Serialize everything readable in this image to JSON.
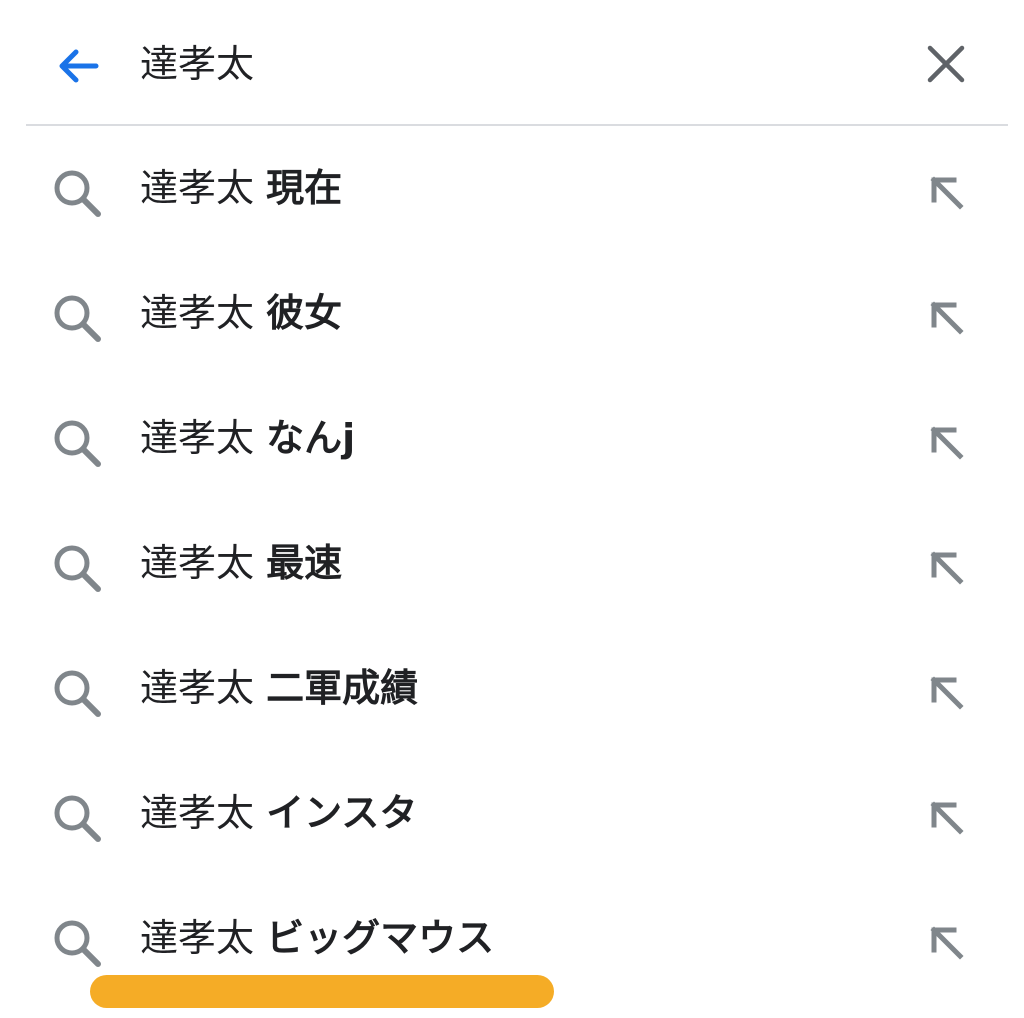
{
  "search": {
    "query": "達孝太",
    "back_icon": "arrow-left-icon",
    "clear_icon": "close-icon"
  },
  "suggestions": [
    {
      "prefix": "達孝太",
      "suffix": "現在"
    },
    {
      "prefix": "達孝太",
      "suffix": "彼女"
    },
    {
      "prefix": "達孝太",
      "suffix": "なんj"
    },
    {
      "prefix": "達孝太",
      "suffix": "最速"
    },
    {
      "prefix": "達孝太",
      "suffix": "二軍成績"
    },
    {
      "prefix": "達孝太",
      "suffix": "インスタ"
    },
    {
      "prefix": "達孝太",
      "suffix": "ビッグマウス"
    }
  ],
  "icons": {
    "suggestion_icon": "search-icon",
    "fill_icon": "arrow-up-left-icon"
  },
  "colors": {
    "accent": "#1a73e8",
    "icon_gray": "#80868b",
    "divider": "#dadce0",
    "highlight": "#f5ac26"
  }
}
